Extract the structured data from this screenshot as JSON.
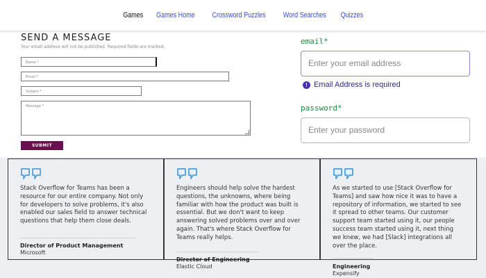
{
  "nav": {
    "items": [
      "Games",
      "Games Home",
      "Crossword Puzzles",
      "Word Searches",
      "Quizzes"
    ]
  },
  "contact_form": {
    "title": "SEND A MESSAGE",
    "note": "Your email address will not be published. Required fields are marked.",
    "name_placeholder": "Name *",
    "email_placeholder": "Email *",
    "subject_placeholder": "Subject *",
    "message_placeholder": "Message *",
    "submit_label": "SUBMIT"
  },
  "login_form": {
    "email_label": "email",
    "email_required_mark": "*",
    "email_placeholder": "Enter your email address",
    "email_error": "Email Address is required",
    "password_label": "password",
    "password_required_mark": "*",
    "password_placeholder": "Enter your password"
  },
  "testimonials": [
    {
      "text": "Stack Overflow for Teams has been a resource for our entire company. Not only for developers to solve problems, it's also enabled our sales field to answer technical questions that help them close deals.",
      "role": "Director of Product Management",
      "org": "Microsoft"
    },
    {
      "text": "Engineers should help solve the hardest questions, the unknowns, where being familiar with how the product was built is essential. But we don't want to keep answering solved problems over and over again. That's where Stack Overflow for Teams really helps.",
      "role": "Director of Engineering",
      "org": "Elastic Cloud"
    },
    {
      "text": "As we started to use [Stack Overflow for Teams] and saw how nice it was to have a repository of information, we started to see it spread to other teams. Our customer support team started using it, our people success team started using it, next thing we knew, we had [Slack] integrations all over the place.",
      "role": "Engineering",
      "org": "Expensify"
    }
  ],
  "colors": {
    "nav_link": "#3a4bd8",
    "submit_bg": "#6b0f4e",
    "label_green": "#1f8a3b",
    "error_text": "#2d2a8c",
    "quote_icon": "#5aa9e6",
    "band_bg": "#edf0f3"
  },
  "icons": {
    "quote": "quote-icon",
    "error": "exclamation-circle-icon"
  }
}
